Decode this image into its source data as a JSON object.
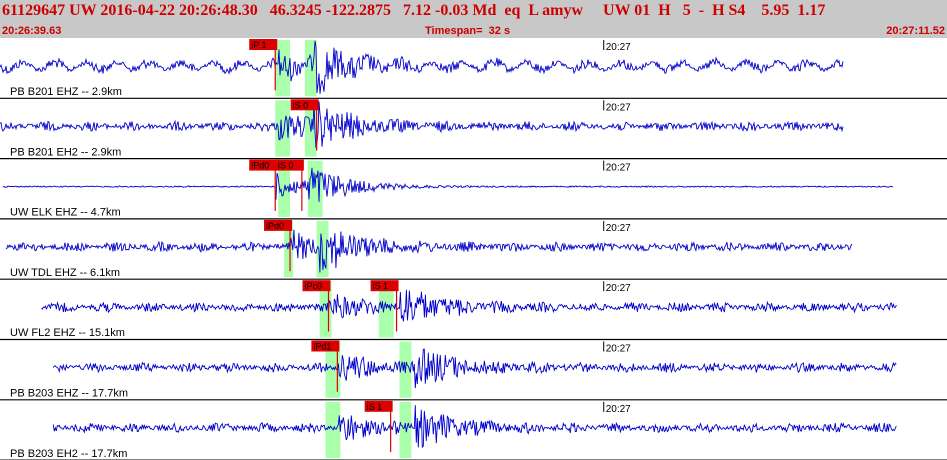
{
  "header": {
    "line": "61129647 UW 2016-04-22 20:26:48.30   46.3245 -122.2875   7.12 -0.03 Md  eq  L amyw     UW 01  H   5  -  H S4    5.95  1.17",
    "start_time": "20:26:39.63",
    "timespan": "Timespan=  32 s",
    "end_time": "20:27:11.52"
  },
  "colors": {
    "trace": "#0000cc",
    "pick": "#dd0000",
    "window": "#aaffaa",
    "divider": "#000000",
    "header_text": "#cc0000"
  },
  "chart_data": {
    "type": "line",
    "title": "",
    "xlabel": "",
    "ylabel": "",
    "xlim": [
      0,
      32
    ],
    "time_tick_label": "20:27",
    "time_tick_sec": 20.4,
    "traces": [
      {
        "label": "PB B201 EHZ -- 2.9km",
        "data_start": 0.0,
        "data_end": 28.5,
        "picks": [
          {
            "label": "iP 1",
            "t": 9.3
          }
        ],
        "windows": [
          [
            9.3,
            9.8
          ],
          [
            10.3,
            10.7
          ]
        ],
        "p_arrival": 9.4,
        "s_arrival": 10.6
      },
      {
        "label": "PB B201 EH2 -- 2.9km",
        "data_start": 0.0,
        "data_end": 28.5,
        "picks": [
          {
            "label": "iS 0",
            "t": 10.7
          }
        ],
        "windows": [
          [
            9.3,
            9.8
          ],
          [
            10.3,
            10.7
          ]
        ],
        "p_arrival": 9.4,
        "s_arrival": 10.6
      },
      {
        "label": "UW ELK EHZ -- 4.7km",
        "data_start": 0.1,
        "data_end": 30.2,
        "picks": [
          {
            "label": "iPd0",
            "t": 9.3
          },
          {
            "label": "iS 0",
            "t": 10.2
          }
        ],
        "windows": [
          [
            9.4,
            9.8
          ],
          [
            10.4,
            10.9
          ]
        ],
        "p_arrival": 9.3,
        "s_arrival": 10.4
      },
      {
        "label": "UW TDL EHZ -- 6.1km",
        "data_start": 0.2,
        "data_end": 28.8,
        "picks": [
          {
            "label": "iPd0",
            "t": 9.8
          }
        ],
        "windows": [
          [
            9.6,
            9.9
          ],
          [
            10.7,
            11.1
          ]
        ],
        "p_arrival": 9.8,
        "s_arrival": 10.8
      },
      {
        "label": "UW FL2 EHZ -- 15.1km",
        "data_start": 1.4,
        "data_end": 30.3,
        "picks": [
          {
            "label": "iPc0",
            "t": 11.1
          },
          {
            "label": "iS 1",
            "t": 13.4
          }
        ],
        "windows": [
          [
            10.8,
            11.2
          ],
          [
            12.8,
            13.3
          ]
        ],
        "p_arrival": 11.1,
        "s_arrival": 13.5
      },
      {
        "label": "PB B203 EHZ -- 17.7km",
        "data_start": 1.8,
        "data_end": 30.3,
        "picks": [
          {
            "label": "iPd1",
            "t": 11.4
          }
        ],
        "windows": [
          [
            11.0,
            11.5
          ],
          [
            13.5,
            13.9
          ]
        ],
        "p_arrival": 11.4,
        "s_arrival": 14.0
      },
      {
        "label": "PB B203 EH2 -- 17.7km",
        "data_start": 1.8,
        "data_end": 30.3,
        "picks": [
          {
            "label": "iS 1",
            "t": 13.2
          }
        ],
        "windows": [
          [
            11.0,
            11.5
          ],
          [
            13.5,
            13.9
          ]
        ],
        "p_arrival": 11.4,
        "s_arrival": 14.0
      }
    ]
  }
}
